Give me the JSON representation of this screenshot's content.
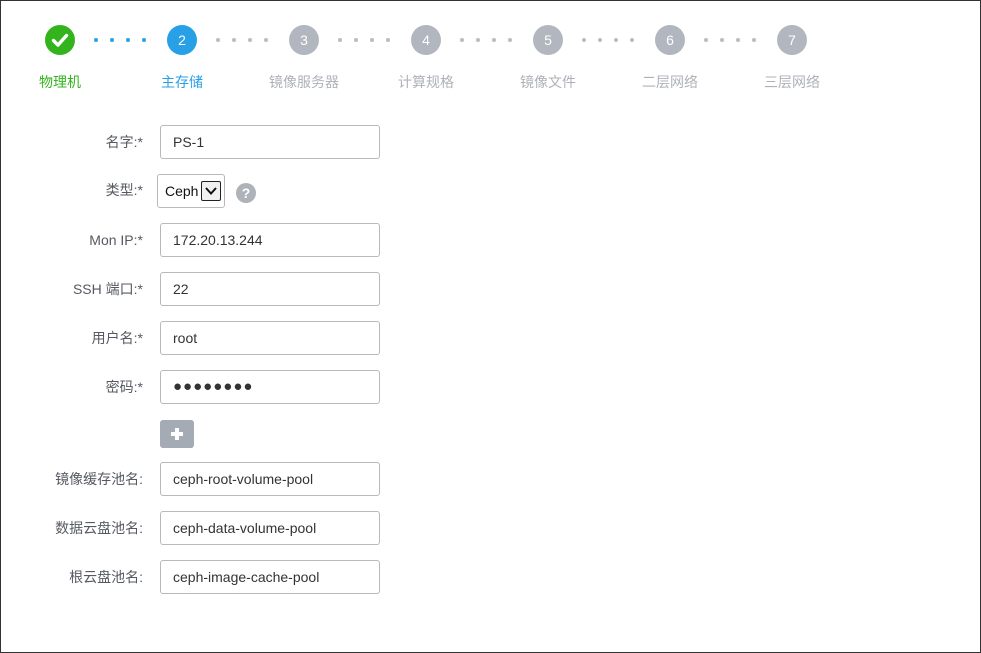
{
  "wizard": {
    "steps": [
      {
        "number": "1",
        "label": "物理机",
        "status": "done"
      },
      {
        "number": "2",
        "label": "主存储",
        "status": "active"
      },
      {
        "number": "3",
        "label": "镜像服务器",
        "status": "pending"
      },
      {
        "number": "4",
        "label": "计算规格",
        "status": "pending"
      },
      {
        "number": "5",
        "label": "镜像文件",
        "status": "pending"
      },
      {
        "number": "6",
        "label": "二层网络",
        "status": "pending"
      },
      {
        "number": "7",
        "label": "三层网络",
        "status": "pending"
      }
    ],
    "colors": {
      "done": "#34b41c",
      "active": "#27a0e6",
      "pending": "#b2b7bf"
    }
  },
  "form": {
    "required_mark": "*",
    "name": {
      "label": "名字:",
      "value": "PS-1"
    },
    "type": {
      "label": "类型:",
      "value": "Ceph",
      "help_icon": "question-circle-icon"
    },
    "mon_ip": {
      "label": "Mon IP:",
      "value": "172.20.13.244"
    },
    "ssh_port": {
      "label": "SSH 端口:",
      "value": "22"
    },
    "username": {
      "label": "用户名:",
      "value": "root"
    },
    "password": {
      "label": "密码:",
      "value": "●●●●●●●●"
    },
    "add_button": {
      "icon": "plus-icon"
    },
    "image_cache_pool": {
      "label": "镜像缓存池名:",
      "value": "ceph-root-volume-pool"
    },
    "data_volume_pool": {
      "label": "数据云盘池名:",
      "value": "ceph-data-volume-pool"
    },
    "root_volume_pool": {
      "label": "根云盘池名:",
      "value": "ceph-image-cache-pool"
    }
  }
}
